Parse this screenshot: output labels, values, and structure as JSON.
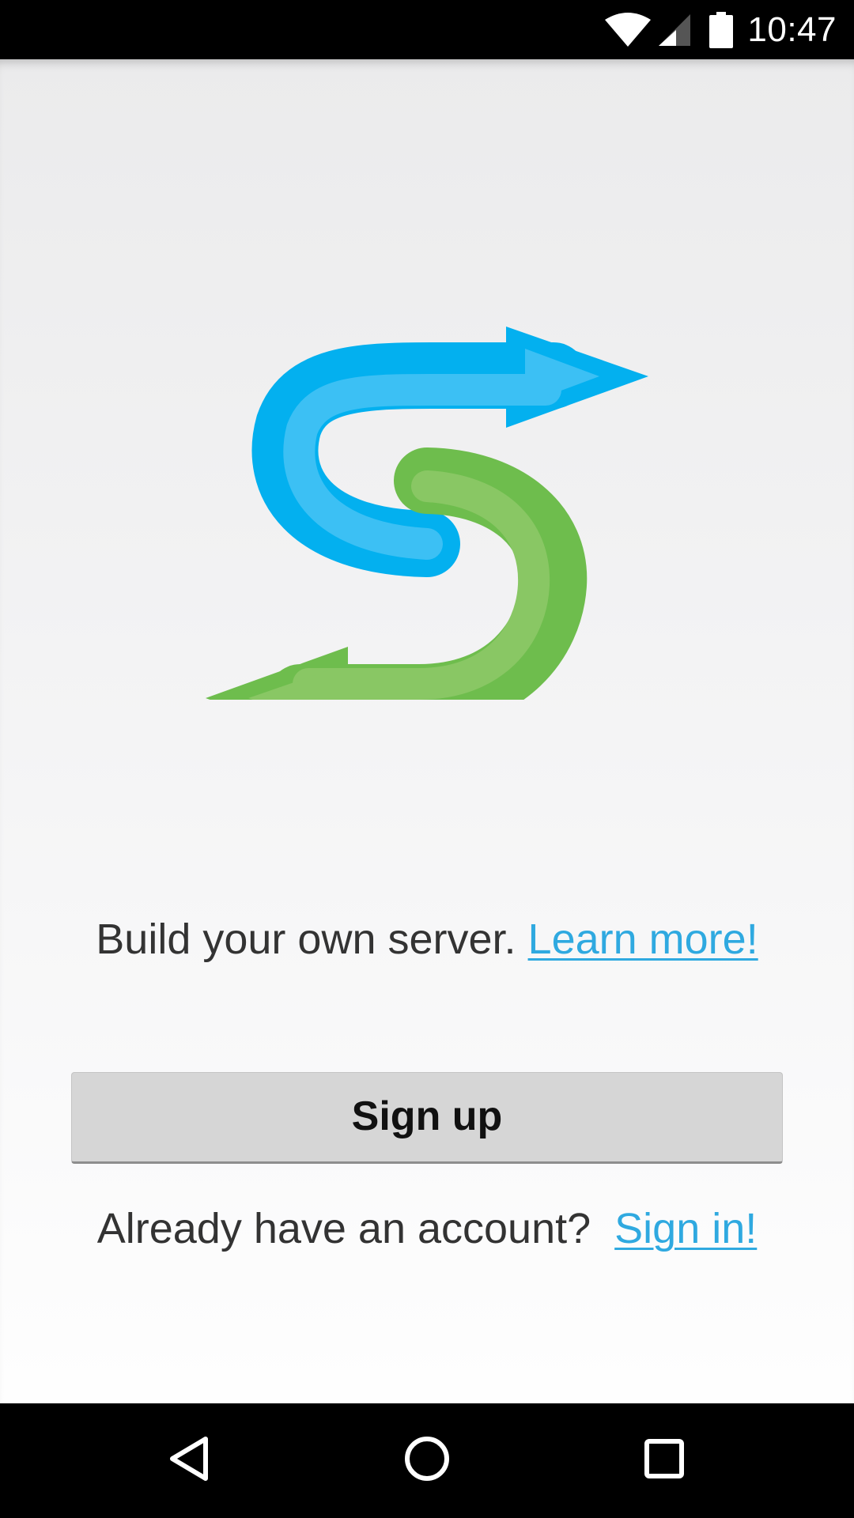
{
  "status_bar": {
    "time": "10:47",
    "icons": [
      "wifi-icon",
      "cell-signal-icon",
      "battery-icon"
    ]
  },
  "logo": {
    "name": "sync-arrows-logo",
    "colors": {
      "blue_outer": "#03b0ef",
      "blue_inner": "#3cc0f4",
      "green_outer": "#6ebd4d",
      "green_inner": "#89c764"
    }
  },
  "tagline": {
    "text": "Build your own server.",
    "link_label": "Learn more!"
  },
  "signup_button": {
    "label": "Sign up"
  },
  "signin": {
    "prompt": "Already have an account?",
    "link_label": "Sign in!"
  },
  "nav_bar": {
    "buttons": [
      "back-icon",
      "home-icon",
      "recents-icon"
    ]
  },
  "colors": {
    "link": "#2fa9e0",
    "text": "#333333",
    "button_bg": "#d6d6d6"
  }
}
